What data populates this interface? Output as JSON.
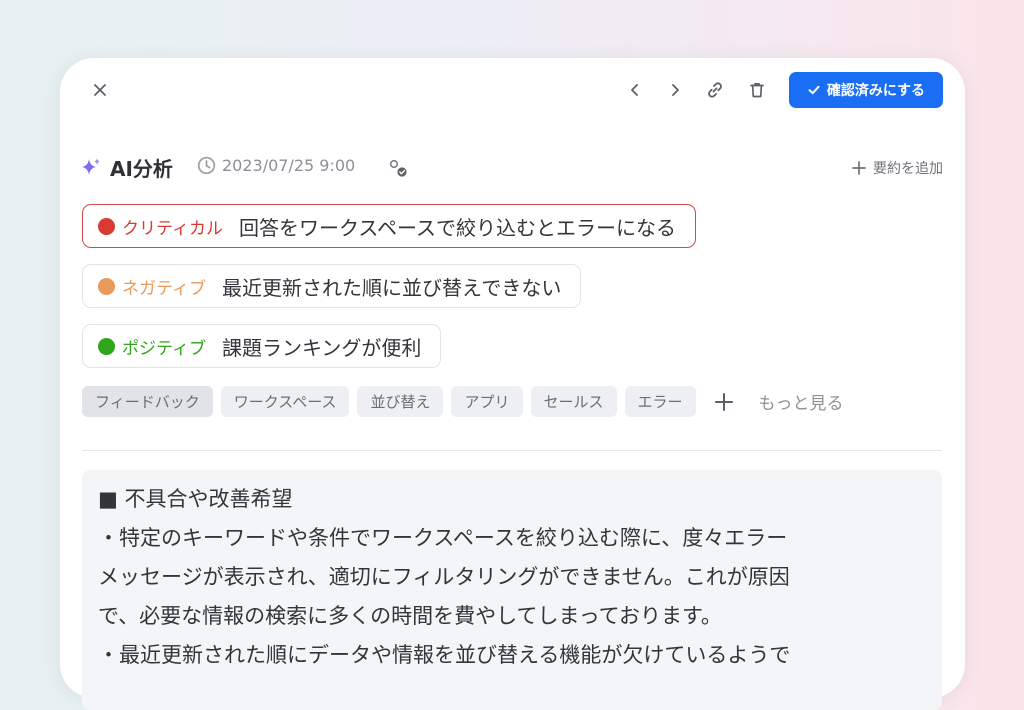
{
  "toolbar": {
    "close_icon": "close-icon",
    "prev_icon": "chevron-left-icon",
    "next_icon": "chevron-right-icon",
    "link_icon": "link-icon",
    "delete_icon": "trash-icon",
    "confirm_label": "確認済みにする",
    "confirm_color": "#1a6ef3"
  },
  "analysis": {
    "title": "AI分析",
    "timestamp": "2023/07/25 9:00",
    "add_summary_label": "要約を追加"
  },
  "insights": [
    {
      "type": "critical",
      "label": "クリティカル",
      "text": "回答をワークスペースで絞り込むとエラーになる",
      "color": "#d93a32"
    },
    {
      "type": "negative",
      "label": "ネガティブ",
      "text": "最近更新された順に並び替えできない",
      "color": "#e89a5a"
    },
    {
      "type": "positive",
      "label": "ポジティブ",
      "text": "課題ランキングが便利",
      "color": "#2ea51a"
    }
  ],
  "tags": [
    "フィードバック",
    "ワークスペース",
    "並び替え",
    "アプリ",
    "セールス",
    "エラー"
  ],
  "more_label": "もっと見る",
  "summary": {
    "lines": [
      "■ 不具合や改善希望",
      "・特定のキーワードや条件でワークスペースを絞り込む際に、度々エラー",
      "メッセージが表示され、適切にフィルタリングができません。これが原因",
      "で、必要な情報の検索に多くの時間を費やしてしまっております。",
      "・最近更新された順にデータや情報を並び替える機能が欠けているようで"
    ]
  }
}
